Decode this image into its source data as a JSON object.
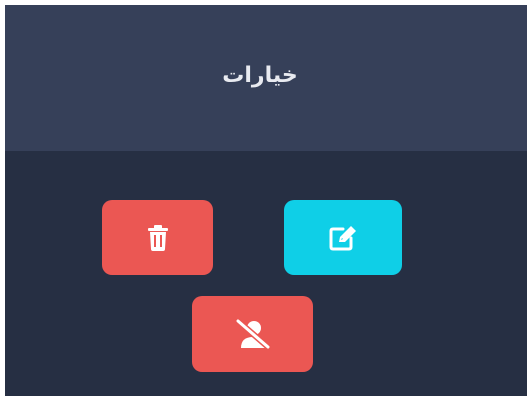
{
  "header": {
    "title": "خيارات"
  },
  "actions": {
    "delete": {
      "icon": "trash-icon",
      "color": "#eb5753"
    },
    "edit": {
      "icon": "edit-icon",
      "color": "#0fcfe7"
    },
    "block_user": {
      "icon": "user-slash-icon",
      "color": "#eb5753"
    }
  },
  "colors": {
    "panel_bg": "#262f43",
    "header_bg": "#364059",
    "title_text": "#e8eaf0"
  }
}
